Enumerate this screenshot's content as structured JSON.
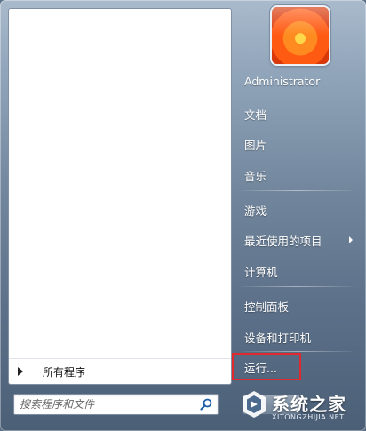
{
  "left_panel": {
    "all_programs_label": "所有程序"
  },
  "search": {
    "placeholder": "搜索程序和文件"
  },
  "right_menu": {
    "user_name": "Administrator",
    "items": [
      {
        "label": "文档"
      },
      {
        "label": "图片"
      },
      {
        "label": "音乐"
      },
      {
        "label": "游戏"
      },
      {
        "label": "最近使用的项目"
      },
      {
        "label": "计算机"
      },
      {
        "label": "控制面板"
      },
      {
        "label": "设备和打印机"
      },
      {
        "label": "运行..."
      }
    ]
  },
  "watermark": {
    "title": "系统之家",
    "subtitle": "XITONGZHIJIA.NET"
  },
  "colors": {
    "highlight_box": "#e0282e",
    "panel_bg": "#ffffff"
  }
}
